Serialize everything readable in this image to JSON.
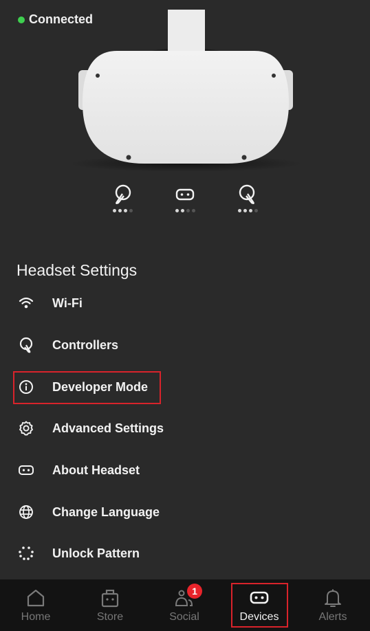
{
  "status": {
    "label": "Connected",
    "color": "#3ecf4f"
  },
  "devices": [
    {
      "name": "left-controller",
      "battery_level": 3,
      "battery_max": 4
    },
    {
      "name": "headset",
      "battery_level": 2,
      "battery_max": 4
    },
    {
      "name": "right-controller",
      "battery_level": 3,
      "battery_max": 4
    }
  ],
  "section_title": "Headset Settings",
  "menu": [
    {
      "label": "Wi-Fi",
      "icon": "wifi-icon"
    },
    {
      "label": "Controllers",
      "icon": "controller-icon"
    },
    {
      "label": "Developer Mode",
      "icon": "info-icon",
      "highlighted": true
    },
    {
      "label": "Advanced Settings",
      "icon": "gear-icon"
    },
    {
      "label": "About Headset",
      "icon": "headset-icon"
    },
    {
      "label": "Change Language",
      "icon": "globe-icon"
    },
    {
      "label": "Unlock Pattern",
      "icon": "pattern-icon"
    }
  ],
  "tabs": [
    {
      "label": "Home",
      "icon": "home-icon"
    },
    {
      "label": "Store",
      "icon": "store-icon"
    },
    {
      "label": "Social",
      "icon": "social-icon",
      "badge": "1"
    },
    {
      "label": "Devices",
      "icon": "headset-icon",
      "active": true
    },
    {
      "label": "Alerts",
      "icon": "bell-icon"
    }
  ],
  "colors": {
    "accent_red": "#d9232b",
    "badge_red": "#e8242b",
    "background": "#2a2a2a",
    "tabbar": "#131313"
  }
}
